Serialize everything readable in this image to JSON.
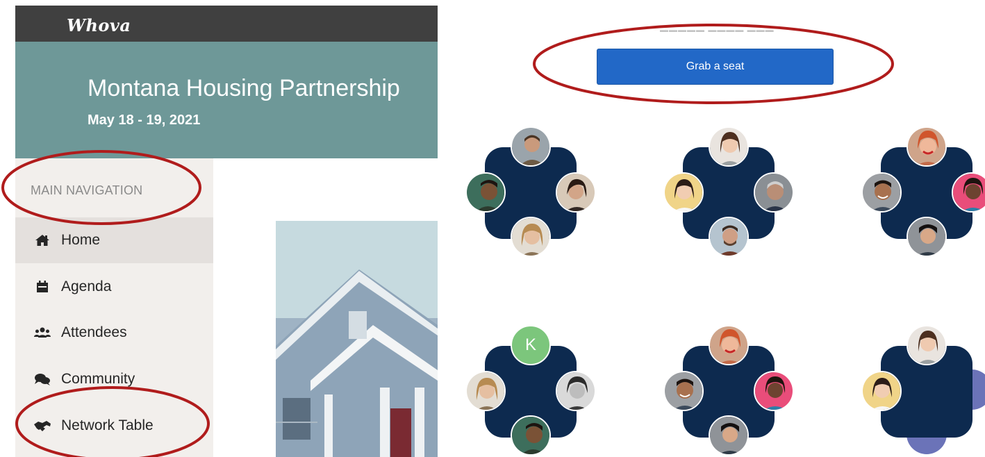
{
  "app": {
    "logo_text": "Whova"
  },
  "event": {
    "title": "Montana Housing Partnership",
    "dates": "May 18 - 19, 2021"
  },
  "sidebar": {
    "heading": "MAIN NAVIGATION",
    "items": [
      {
        "label": "Home",
        "icon": "home-icon",
        "active": true
      },
      {
        "label": "Agenda",
        "icon": "calendar-icon",
        "active": false
      },
      {
        "label": "Attendees",
        "icon": "users-icon",
        "active": false
      },
      {
        "label": "Community",
        "icon": "comments-icon",
        "active": false
      },
      {
        "label": "Network Table",
        "icon": "handshake-icon",
        "active": false
      }
    ]
  },
  "network_tables": {
    "grab_seat_label": "Grab a seat",
    "tables": [
      {
        "seats": [
          "avatar",
          "avatar",
          "avatar",
          "avatar"
        ]
      },
      {
        "seats": [
          "avatar",
          "avatar",
          "avatar",
          "avatar"
        ]
      },
      {
        "seats": [
          "avatar",
          "avatar",
          "avatar",
          "avatar"
        ]
      },
      {
        "seats": [
          "avatar",
          "avatar",
          "avatar",
          "avatar"
        ],
        "initial": "K"
      },
      {
        "seats": [
          "avatar",
          "avatar",
          "avatar",
          "avatar"
        ]
      },
      {
        "seats": [
          "avatar",
          "avatar",
          "empty",
          "empty"
        ]
      }
    ]
  },
  "colors": {
    "topbar": "#404040",
    "banner": "#6e9898",
    "table": "#0d2a4f",
    "button": "#2268c7",
    "highlight_ring": "#b01c1c",
    "empty_seat": "#6b73b8",
    "initial_seat": "#7cc67c"
  }
}
